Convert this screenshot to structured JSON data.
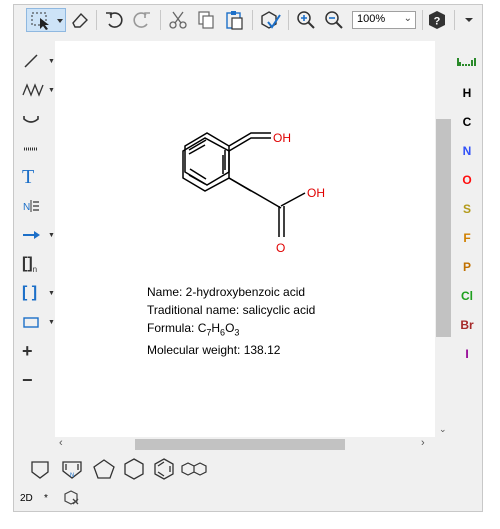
{
  "toolbar": {
    "zoom_value": "100%"
  },
  "molecule": {
    "atom_labels": {
      "oh_top": "OH",
      "oh_right": "OH",
      "o_bottom": "O"
    },
    "name_line": "Name: 2-hydroxybenzoic acid",
    "traditional_line": "Traditional name: salicyclic acid",
    "formula_prefix": "Formula: ",
    "formula_parts": [
      "C",
      "7",
      "H",
      "6",
      "O",
      "3"
    ],
    "weight_line": "Molecular weight: 138.12"
  },
  "left_tools": {
    "text_tool": "T",
    "bracket_tool": "[]",
    "bracket_sub": "n",
    "sgroup_tool": "[ ]",
    "plus_tool": "+",
    "minus_tool": "−"
  },
  "atoms": [
    {
      "symbol": "H",
      "color": "#000000"
    },
    {
      "symbol": "C",
      "color": "#000000"
    },
    {
      "symbol": "N",
      "color": "#3050f8"
    },
    {
      "symbol": "O",
      "color": "#ff0d0d"
    },
    {
      "symbol": "S",
      "color": "#b39a1a"
    },
    {
      "symbol": "F",
      "color": "#d08000"
    },
    {
      "symbol": "P",
      "color": "#c07000"
    },
    {
      "symbol": "Cl",
      "color": "#1fa01f"
    },
    {
      "symbol": "Br",
      "color": "#a62929"
    },
    {
      "symbol": "I",
      "color": "#940094"
    }
  ],
  "status": {
    "mode": "2D",
    "star": "*"
  },
  "colors": {
    "accent_blue": "#1c6fc8",
    "oxygen_red": "#e00000"
  }
}
